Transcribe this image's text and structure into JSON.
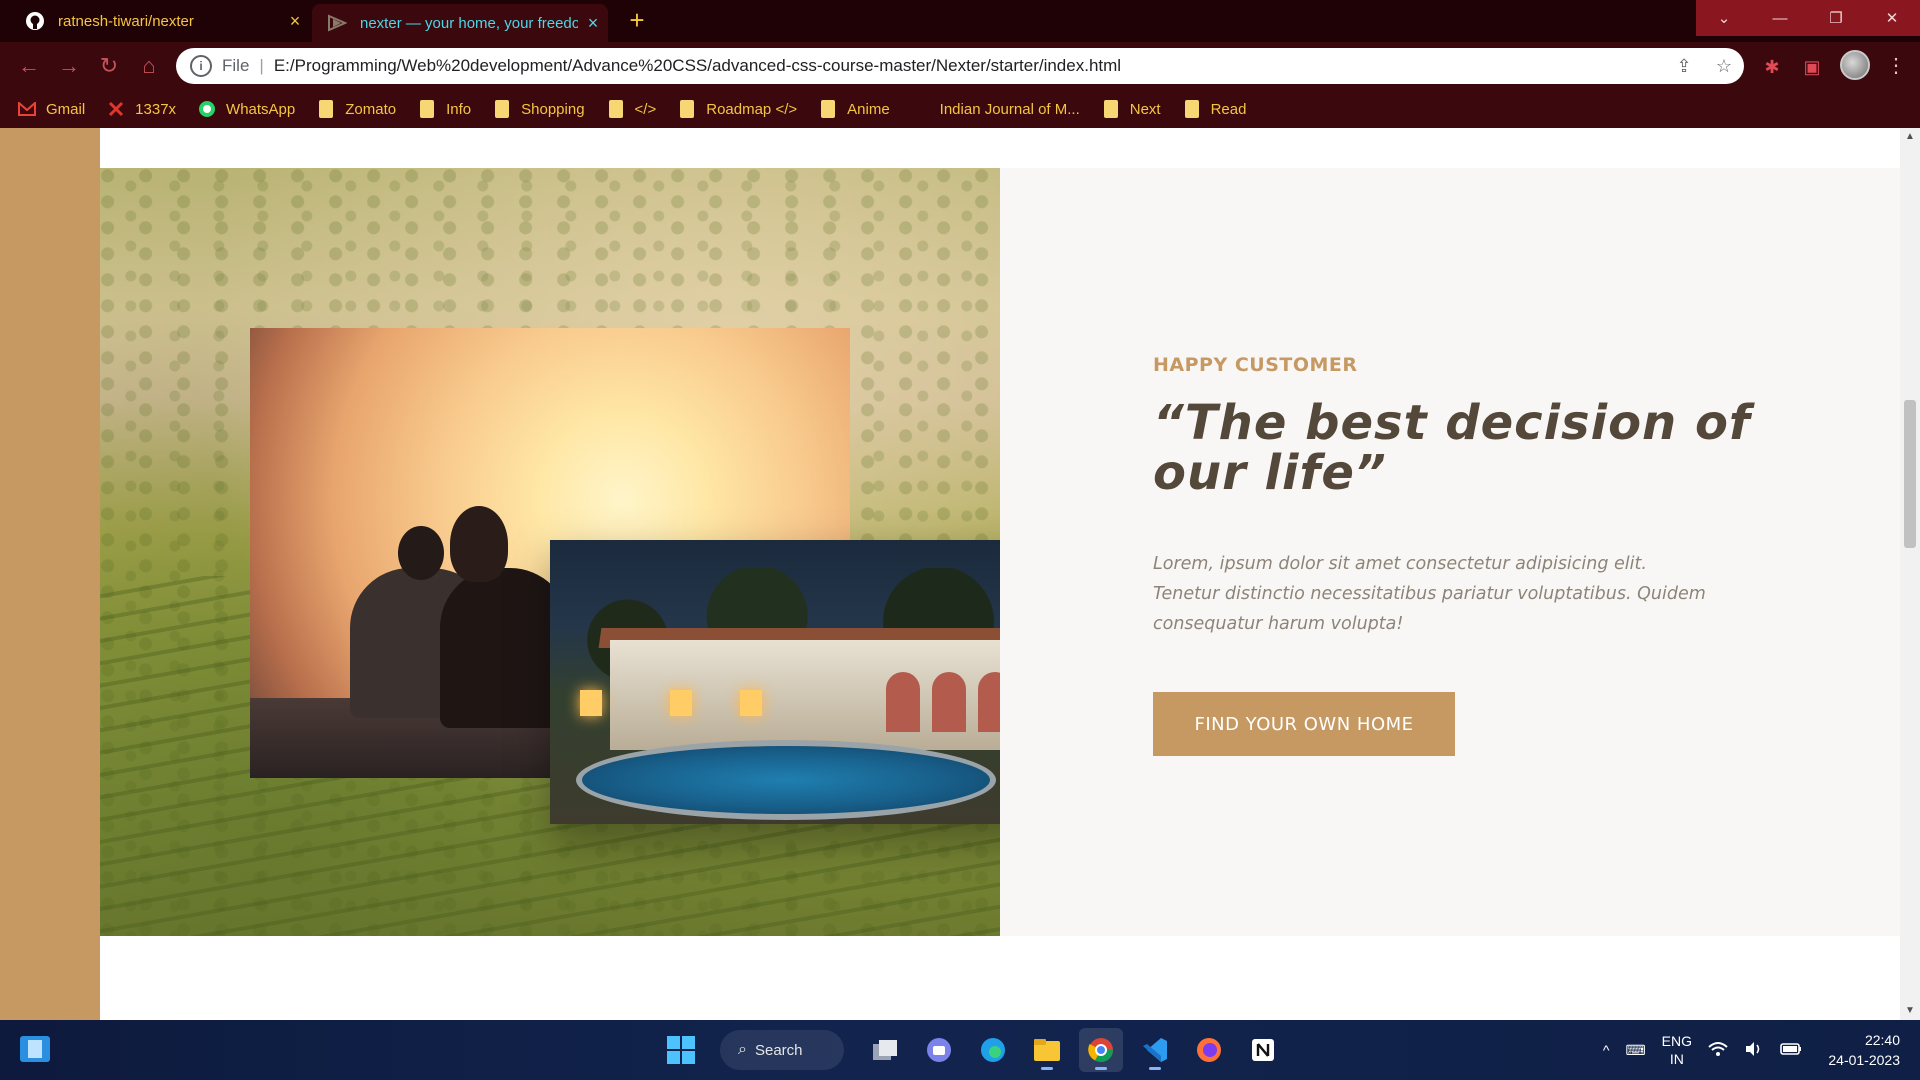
{
  "browser": {
    "tabs": [
      {
        "title": "ratnesh-tiwari/nexter",
        "close": "×",
        "favicon": "github-icon"
      },
      {
        "title": "nexter — your home, your freedom",
        "close": "×",
        "favicon": "nexter-logo-icon"
      }
    ],
    "new_tab": "+",
    "window_controls": {
      "dropdown": "⌄",
      "minimize": "—",
      "restore": "❐",
      "close": "✕"
    },
    "nav": {
      "back": "←",
      "forward": "→",
      "reload": "↻",
      "home": "⌂"
    },
    "address": {
      "info": "i",
      "scheme_label": "File",
      "separator": "|",
      "url": "E:/Programming/Web%20development/Advance%20CSS/advanced-css-course-master/Nexter/starter/index.html"
    },
    "omnibox_icons": {
      "share": "⇪",
      "bookmark": "☆"
    },
    "extensions": {
      "puzzle": "✱",
      "sidepanel": "▣"
    },
    "menu": "⋮",
    "bookmarks": [
      {
        "label": "Gmail",
        "icon": "gmail-icon"
      },
      {
        "label": "1337x",
        "icon": "1337x-icon"
      },
      {
        "label": "WhatsApp",
        "icon": "whatsapp-icon"
      },
      {
        "label": "Zomato",
        "icon": "folder-icon"
      },
      {
        "label": "Info",
        "icon": "folder-icon"
      },
      {
        "label": "Shopping",
        "icon": "folder-icon"
      },
      {
        "label": "</>",
        "icon": "folder-icon"
      },
      {
        "label": "Roadmap </>",
        "icon": "folder-icon"
      },
      {
        "label": "Anime",
        "icon": "folder-icon"
      },
      {
        "label": "Indian Journal of M...",
        "icon": "none"
      },
      {
        "label": "Next",
        "icon": "folder-icon"
      },
      {
        "label": "Read",
        "icon": "folder-icon"
      }
    ]
  },
  "story": {
    "subheading": "Happy Customer",
    "quote": "“The best decision of our life”",
    "text": "Lorem, ipsum dolor sit amet consectetur adipisicing elit. Tenetur distinctio necessitatibus pariatur voluptatibus. Quidem consequatur harum volupta!",
    "cta_label": "Find your own home"
  },
  "colors": {
    "primary": "#c69963",
    "heading": "#54483a",
    "text": "#8d8478",
    "content_bg": "#f9f7f6",
    "chrome_bg": "#3a080d",
    "accent_tab": "#4ed6e8",
    "accent_bookmarks": "#f5c542"
  },
  "scrollbar": {
    "up": "▲",
    "down": "▼"
  },
  "taskbar": {
    "search_label": "Search",
    "apps": [
      "task-view-icon",
      "teams-chat-icon",
      "edge-icon",
      "file-explorer-icon",
      "chrome-icon",
      "vscode-icon",
      "firefox-icon",
      "notion-icon"
    ],
    "tray": {
      "chevron": "^",
      "keyboard": "⌨",
      "lang_1": "ENG",
      "lang_2": "IN",
      "wifi": "wifi-icon",
      "volume": "volume-icon",
      "battery": "battery-icon"
    },
    "time": "22:40",
    "date": "24-01-2023"
  }
}
